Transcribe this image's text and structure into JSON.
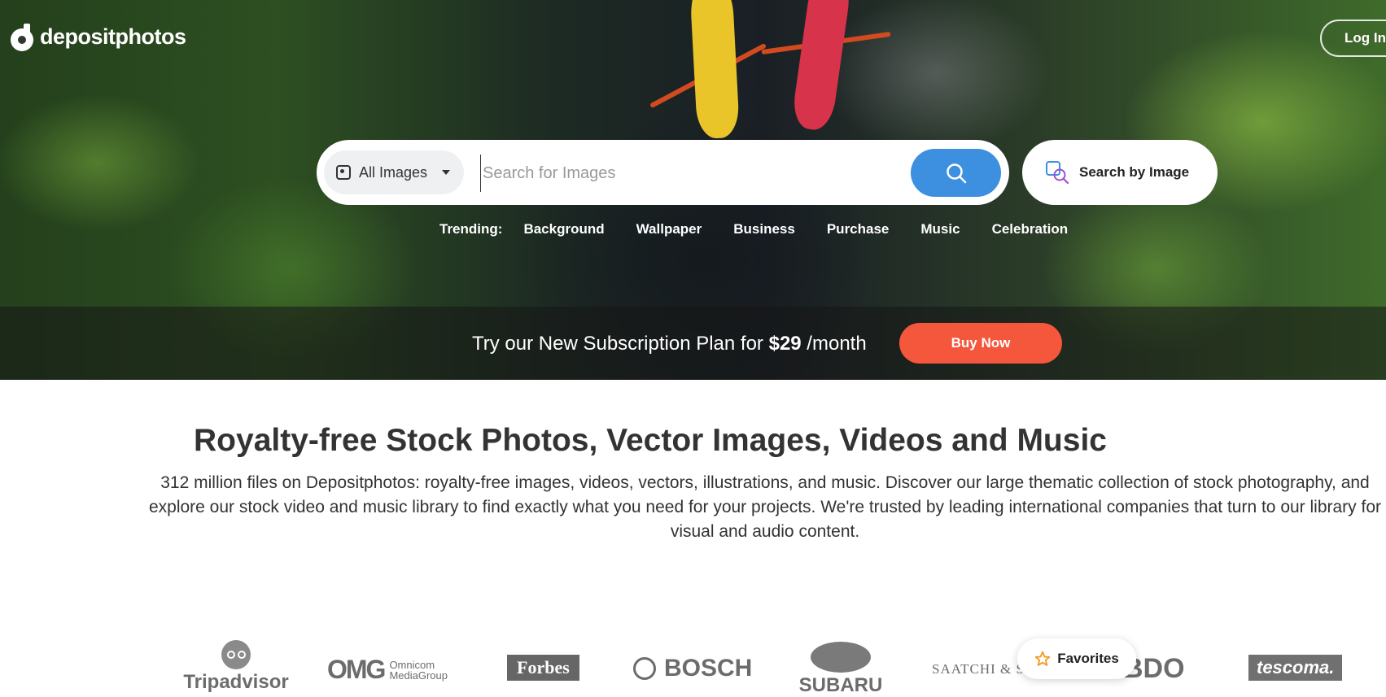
{
  "header": {
    "logo_text": "depositphotos",
    "login_label": "Log In"
  },
  "search": {
    "type_selected": "All Images",
    "placeholder": "Search for Images",
    "value": "",
    "by_image_label": "Search by Image"
  },
  "trending": {
    "label": "Trending:",
    "items": [
      "Background",
      "Wallpaper",
      "Business",
      "Purchase",
      "Music",
      "Celebration"
    ]
  },
  "promo": {
    "text_before": "Try our New Subscription Plan for ",
    "price": "$29",
    "text_after": " /month",
    "button_label": "Buy Now"
  },
  "main": {
    "headline": "Royalty-free Stock Photos, Vector Images, Videos and Music",
    "description": "312 million files on Depositphotos: royalty-free images, videos, vectors, illustrations, and music. Discover our large thematic collection of stock photography, and\nexplore our stock video and music library to find exactly what you need for your projects. We're trusted by leading international companies that turn to our library for\nvisual and audio content."
  },
  "brands": {
    "tripadvisor": "Tripadvisor",
    "omg_big": "OMG",
    "omg_line1": "Omnicom",
    "omg_line2": "MediaGroup",
    "forbes": "Forbes",
    "bosch": "BOSCH",
    "subaru": "SUBARU",
    "saatchi": "SAATCHI & SAATCHI",
    "bdo": "BDO",
    "tescoma": "tescoma."
  },
  "favorites": {
    "label": "Favorites"
  },
  "colors": {
    "search_button": "#3d8fe0",
    "buy_button": "#f4573b",
    "favorites_star": "#f39a21"
  }
}
